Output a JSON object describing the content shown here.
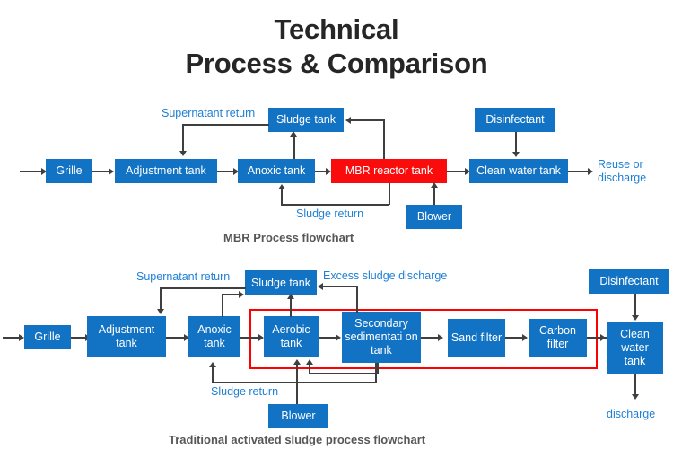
{
  "title": {
    "line1": "Technical",
    "line2": "Process & Comparison"
  },
  "mbr_process": {
    "caption": "MBR Process flowchart",
    "boxes": {
      "grille": "Grille",
      "adjustment_tank": "Adjustment tank",
      "anoxic_tank": "Anoxic tank",
      "mbr_reactor_tank": "MBR reactor  tank",
      "clean_water_tank": "Clean water tank",
      "sludge_tank": "Sludge tank",
      "disinfectant": "Disinfectant",
      "blower": "Blower"
    },
    "labels": {
      "supernatant_return": "Supernatant return",
      "sludge_return": "Sludge return",
      "output": "Reuse or\ndischarge"
    }
  },
  "traditional_process": {
    "caption": "Traditional activated sludge process flowchart",
    "boxes": {
      "grille": "Grille",
      "adjustment_tank": "Adjustment\ntank",
      "anoxic_tank": "Anoxic\ntank",
      "aerobic_tank": "Aerobic\ntank",
      "secondary_sedimentation_tank": "Secondary\nsedimentati\non tank",
      "sand_filter": "Sand\nfilter",
      "carbon_filter": "Carbon\nfilter",
      "clean_water_tank": "Clean\nwater\ntank",
      "sludge_tank": "Sludge tank",
      "disinfectant": "Disinfectant",
      "blower": "Blower"
    },
    "labels": {
      "supernatant_return": "Supernatant return",
      "excess_sludge_discharge": "Excess sludge discharge",
      "sludge_return": "Sludge return",
      "output": "discharge"
    }
  },
  "colors": {
    "box_blue": "#1272C4",
    "highlight_red": "#FB0C0C",
    "frame_red": "#FF0000",
    "label_blue": "#1F7FD4",
    "connector": "#3F3F3F",
    "title_text": "#262626",
    "caption_text": "#575757"
  }
}
